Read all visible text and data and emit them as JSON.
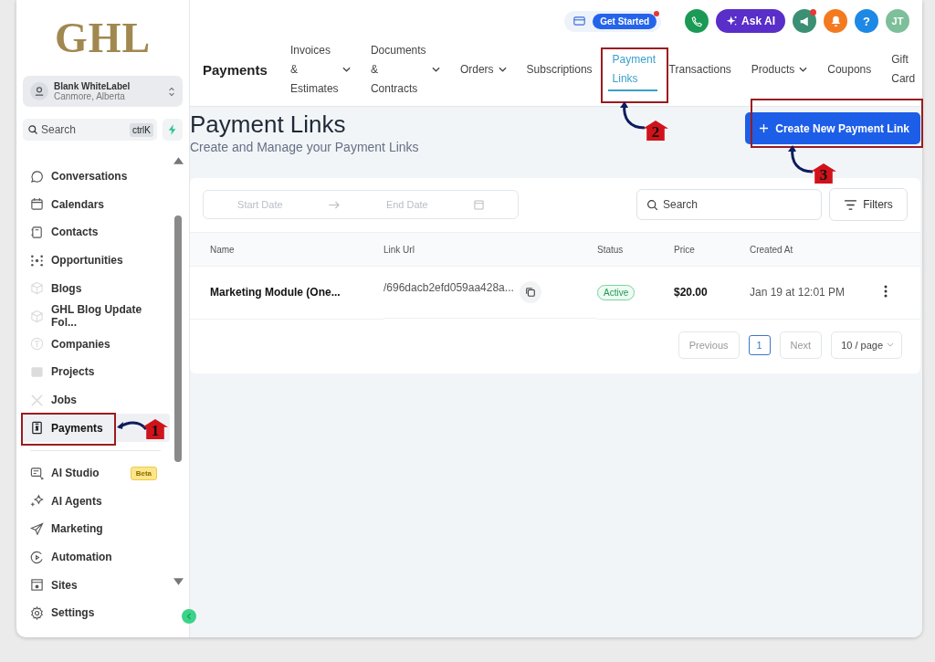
{
  "sidebar": {
    "logo": "GHL",
    "account": {
      "name": "Blank WhiteLabel",
      "location": "Canmore, Alberta"
    },
    "search": {
      "placeholder": "Search",
      "shortcut": "ctrlK"
    },
    "items": [
      {
        "label": "Conversations",
        "faded": false,
        "selected": false
      },
      {
        "label": "Calendars",
        "faded": false,
        "selected": false
      },
      {
        "label": "Contacts",
        "faded": false,
        "selected": false
      },
      {
        "label": "Opportunities",
        "faded": false,
        "selected": false
      },
      {
        "label": "Blogs",
        "faded": true,
        "selected": false
      },
      {
        "label": "GHL Blog Update Fol...",
        "faded": true,
        "selected": false
      },
      {
        "label": "Companies",
        "faded": true,
        "selected": false
      },
      {
        "label": "Projects",
        "faded": true,
        "selected": false
      },
      {
        "label": "Jobs",
        "faded": true,
        "selected": false
      },
      {
        "label": "Payments",
        "faded": false,
        "selected": true
      }
    ],
    "items_2": [
      {
        "label": "AI Studio",
        "badge": "Beta"
      },
      {
        "label": "AI Agents"
      },
      {
        "label": "Marketing"
      },
      {
        "label": "Automation"
      },
      {
        "label": "Sites"
      },
      {
        "label": "Settings"
      }
    ]
  },
  "topbar": {
    "get_started": "Get Started",
    "ask_ai": "Ask AI",
    "help": "?",
    "avatar": "JT"
  },
  "header": {
    "title": "Payments",
    "tabs": [
      {
        "label": "Invoices & Estimates",
        "dropdown": true,
        "selected": false
      },
      {
        "label": "Documents & Contracts",
        "dropdown": true,
        "selected": false
      },
      {
        "label": "Orders",
        "dropdown": true,
        "selected": false
      },
      {
        "label": "Subscriptions",
        "dropdown": false,
        "selected": false
      },
      {
        "label": "Payment Links",
        "dropdown": false,
        "selected": true
      },
      {
        "label": "Transactions",
        "dropdown": false,
        "selected": false
      },
      {
        "label": "Products",
        "dropdown": true,
        "selected": false
      },
      {
        "label": "Coupons",
        "dropdown": false,
        "selected": false
      },
      {
        "label": "Gift Card",
        "dropdown": false,
        "selected": false
      }
    ]
  },
  "page": {
    "title": "Payment Links",
    "subtitle": "Create and Manage your Payment Links",
    "create_button": "Create New Payment Link"
  },
  "filters": {
    "start_date": "Start Date",
    "end_date": "End Date",
    "search": {
      "placeholder": "Search"
    },
    "filters_button": "Filters"
  },
  "table": {
    "columns": [
      "Name",
      "Link Url",
      "Status",
      "Price",
      "Created At"
    ],
    "rows": [
      {
        "name": "Marketing Module (One...",
        "link_url": "/696dacb2efd059aa428a...",
        "status": "Active",
        "price": "$20.00",
        "created_at": "Jan 19 at 12:01 PM"
      }
    ]
  },
  "pagination": {
    "previous": "Previous",
    "page": "1",
    "next": "Next",
    "page_size": "10 / page"
  },
  "annotations": [
    {
      "number": "1"
    },
    {
      "number": "2"
    },
    {
      "number": "3"
    }
  ]
}
